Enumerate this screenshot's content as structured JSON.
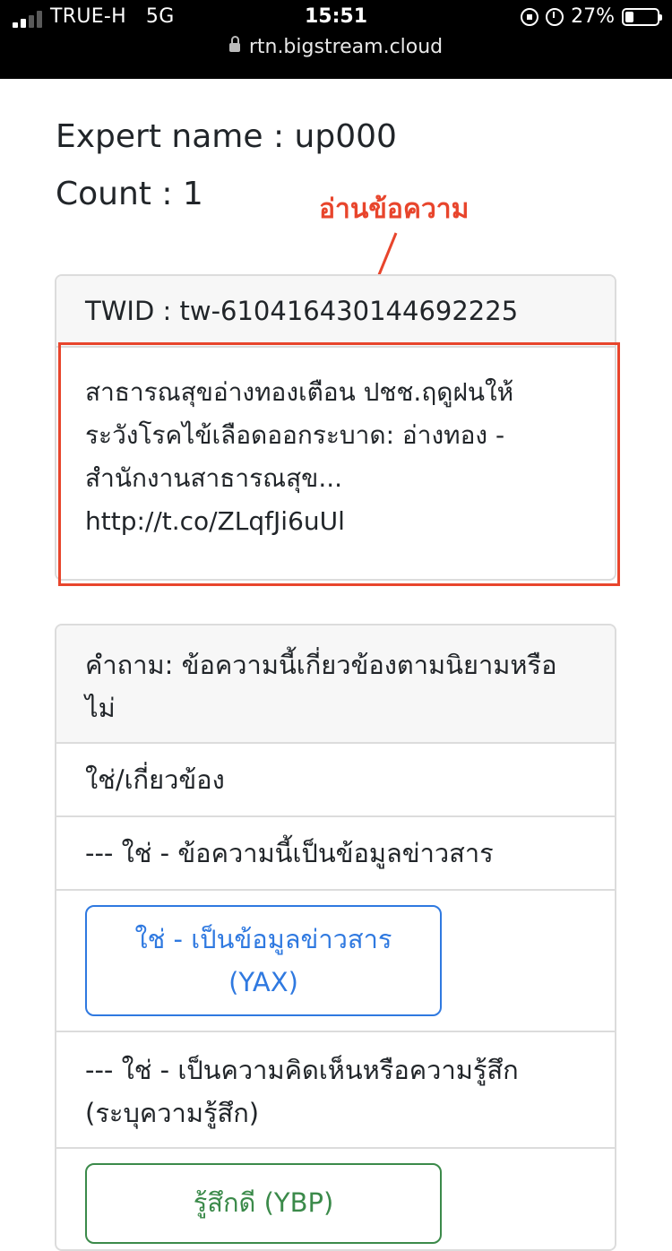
{
  "status_bar": {
    "carrier": "TRUE-H",
    "network": "5G",
    "time": "15:51",
    "battery": "27%",
    "battery_level": 0.27,
    "icons": [
      "signal-icon",
      "rotation-lock-icon",
      "alarm-icon",
      "battery-icon"
    ]
  },
  "browser": {
    "url": "rtn.bigstream.cloud"
  },
  "page": {
    "expert_name": "Expert name : up000",
    "count": "Count : 1"
  },
  "annotation": {
    "label": "อ่านข้อความ",
    "color": "#e8452c"
  },
  "tweet": {
    "twid": "TWID : tw-610416430144692225",
    "lines": [
      "สาธารณสุขอ่างทองเตือน ปชช.ฤดูฝนให้",
      "ระวังโรคไข้เลือดออกระบาด: อ่างทอง -",
      "สำนักงานสาธารณสุข...",
      "http://t.co/ZLqfJi6uUl"
    ]
  },
  "question": {
    "header": [
      "คำถาม: ข้อความนี้เกี่ยวข้องตามนิยามหรือ",
      "ไม่"
    ],
    "related": "ใช่/เกี่ยวข้อง",
    "info_label": "--- ใช่ - ข้อความนี้เป็นข้อมูลข่าวสาร",
    "info_button": [
      "ใช่ - เป็นข้อมูลข่าวสาร",
      "(YAX)"
    ],
    "opinion_label": [
      "--- ใช่ - เป็นความคิดเห็นหรือความรู้สึก",
      "(ระบุความรู้สึก)"
    ],
    "feel_good_button": "รู้สึกดี (YBP)"
  },
  "colors": {
    "accent_blue": "#2f79e0",
    "accent_green": "#3b8a4a",
    "annotation_red": "#e8452c"
  }
}
